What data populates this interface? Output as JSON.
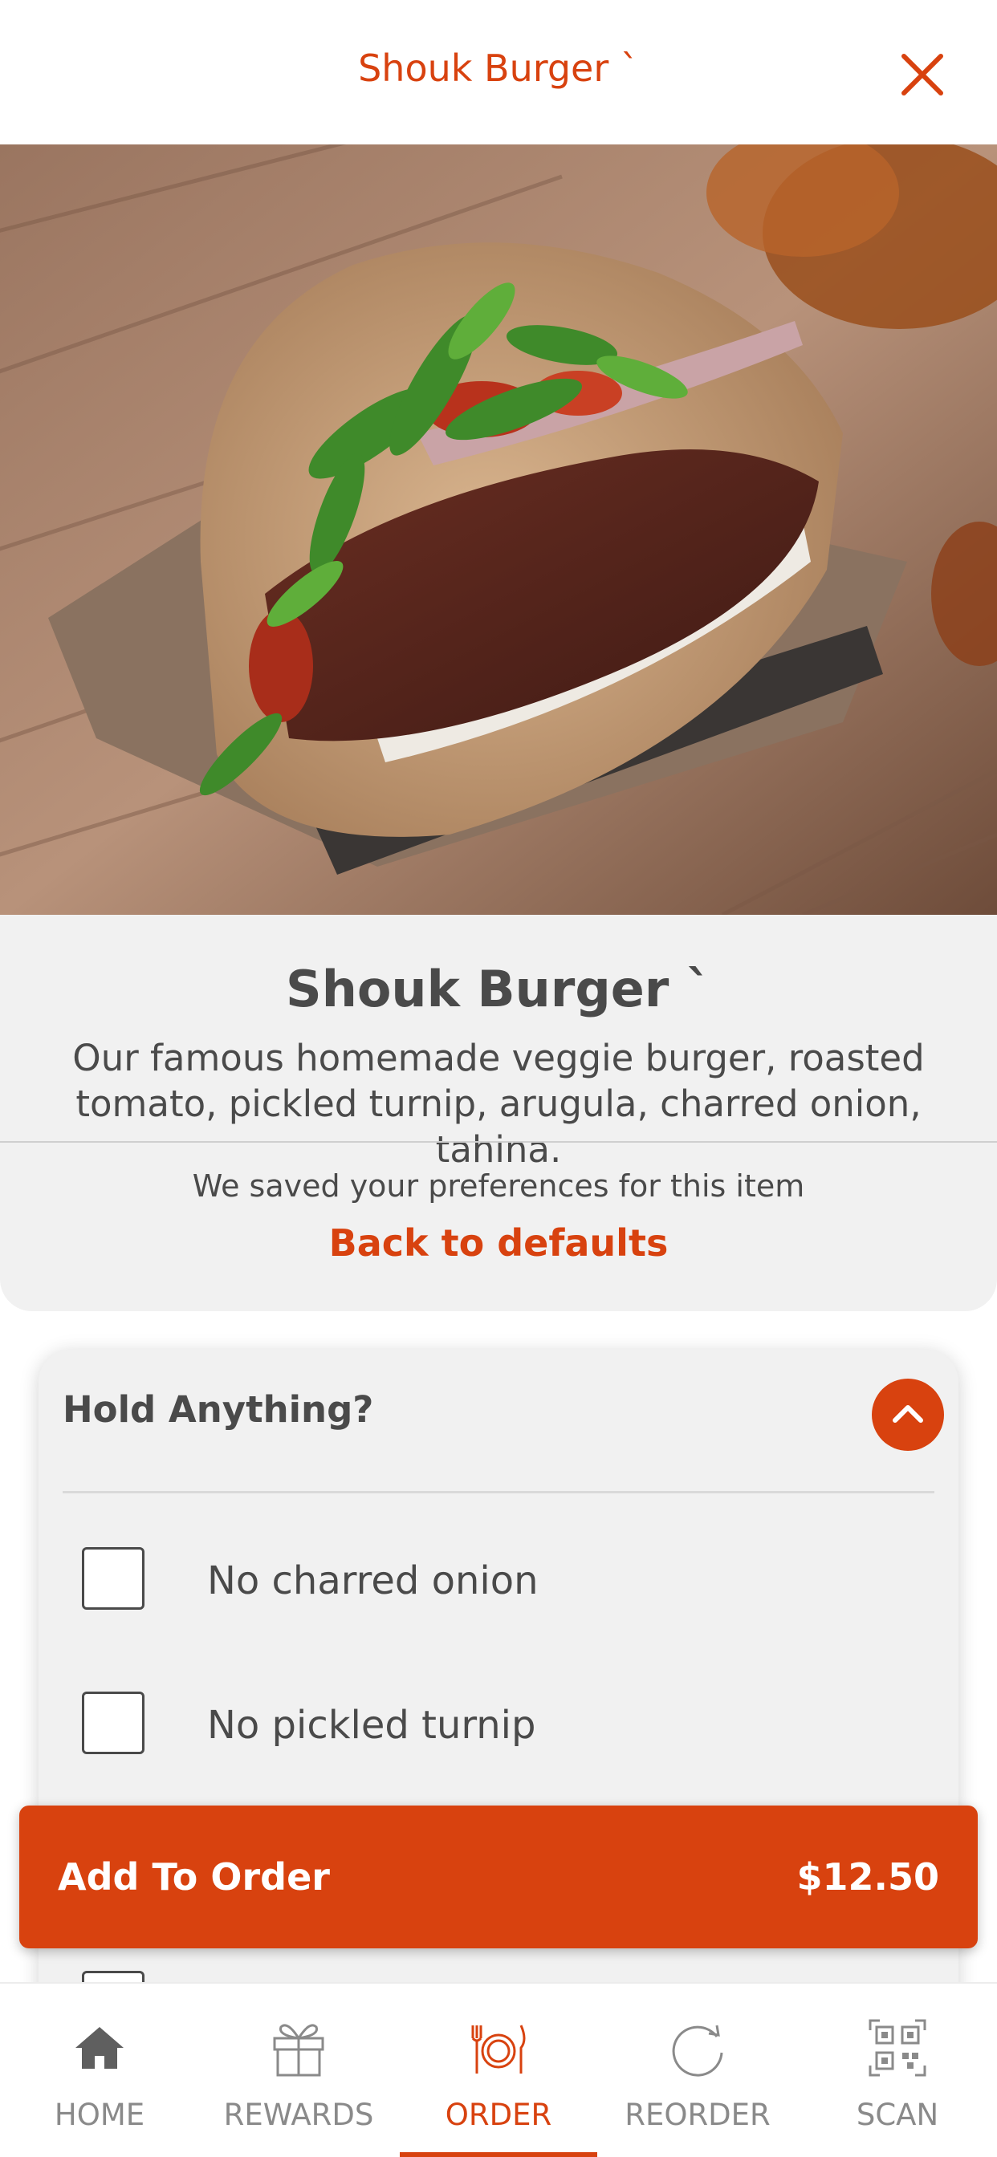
{
  "header": {
    "title": "Shouk Burger `",
    "close_icon": "close-icon"
  },
  "hero": {
    "image": "veggie burger in pita"
  },
  "item": {
    "title": "Shouk Burger `",
    "description": "Our famous homemade veggie burger, roasted tomato, pickled turnip, arugula, charred onion, tahina.",
    "saved_preferences_text": "We saved your preferences for this item",
    "back_to_defaults": "Back to defaults"
  },
  "options": {
    "title": "Hold Anything?",
    "collapse_icon": "chevron-up-icon",
    "items": [
      {
        "label": "No charred onion",
        "checked": false
      },
      {
        "label": "No pickled turnip",
        "checked": false
      },
      {
        "label": "",
        "checked": false
      }
    ]
  },
  "add_to_order": {
    "label": "Add To Order",
    "price": "$12.50"
  },
  "nav": {
    "items": [
      {
        "label": "HOME",
        "icon": "home-icon",
        "active": false
      },
      {
        "label": "REWARDS",
        "icon": "gift-icon",
        "active": false
      },
      {
        "label": "ORDER",
        "icon": "plate-cutlery-icon",
        "active": true
      },
      {
        "label": "REORDER",
        "icon": "refresh-icon",
        "active": false
      },
      {
        "label": "SCAN",
        "icon": "qr-code-icon",
        "active": false
      }
    ]
  },
  "colors": {
    "accent": "#d8420f",
    "panel": "#f1f1f1",
    "text": "#4a4a4a",
    "muted": "#8a8a8a"
  }
}
